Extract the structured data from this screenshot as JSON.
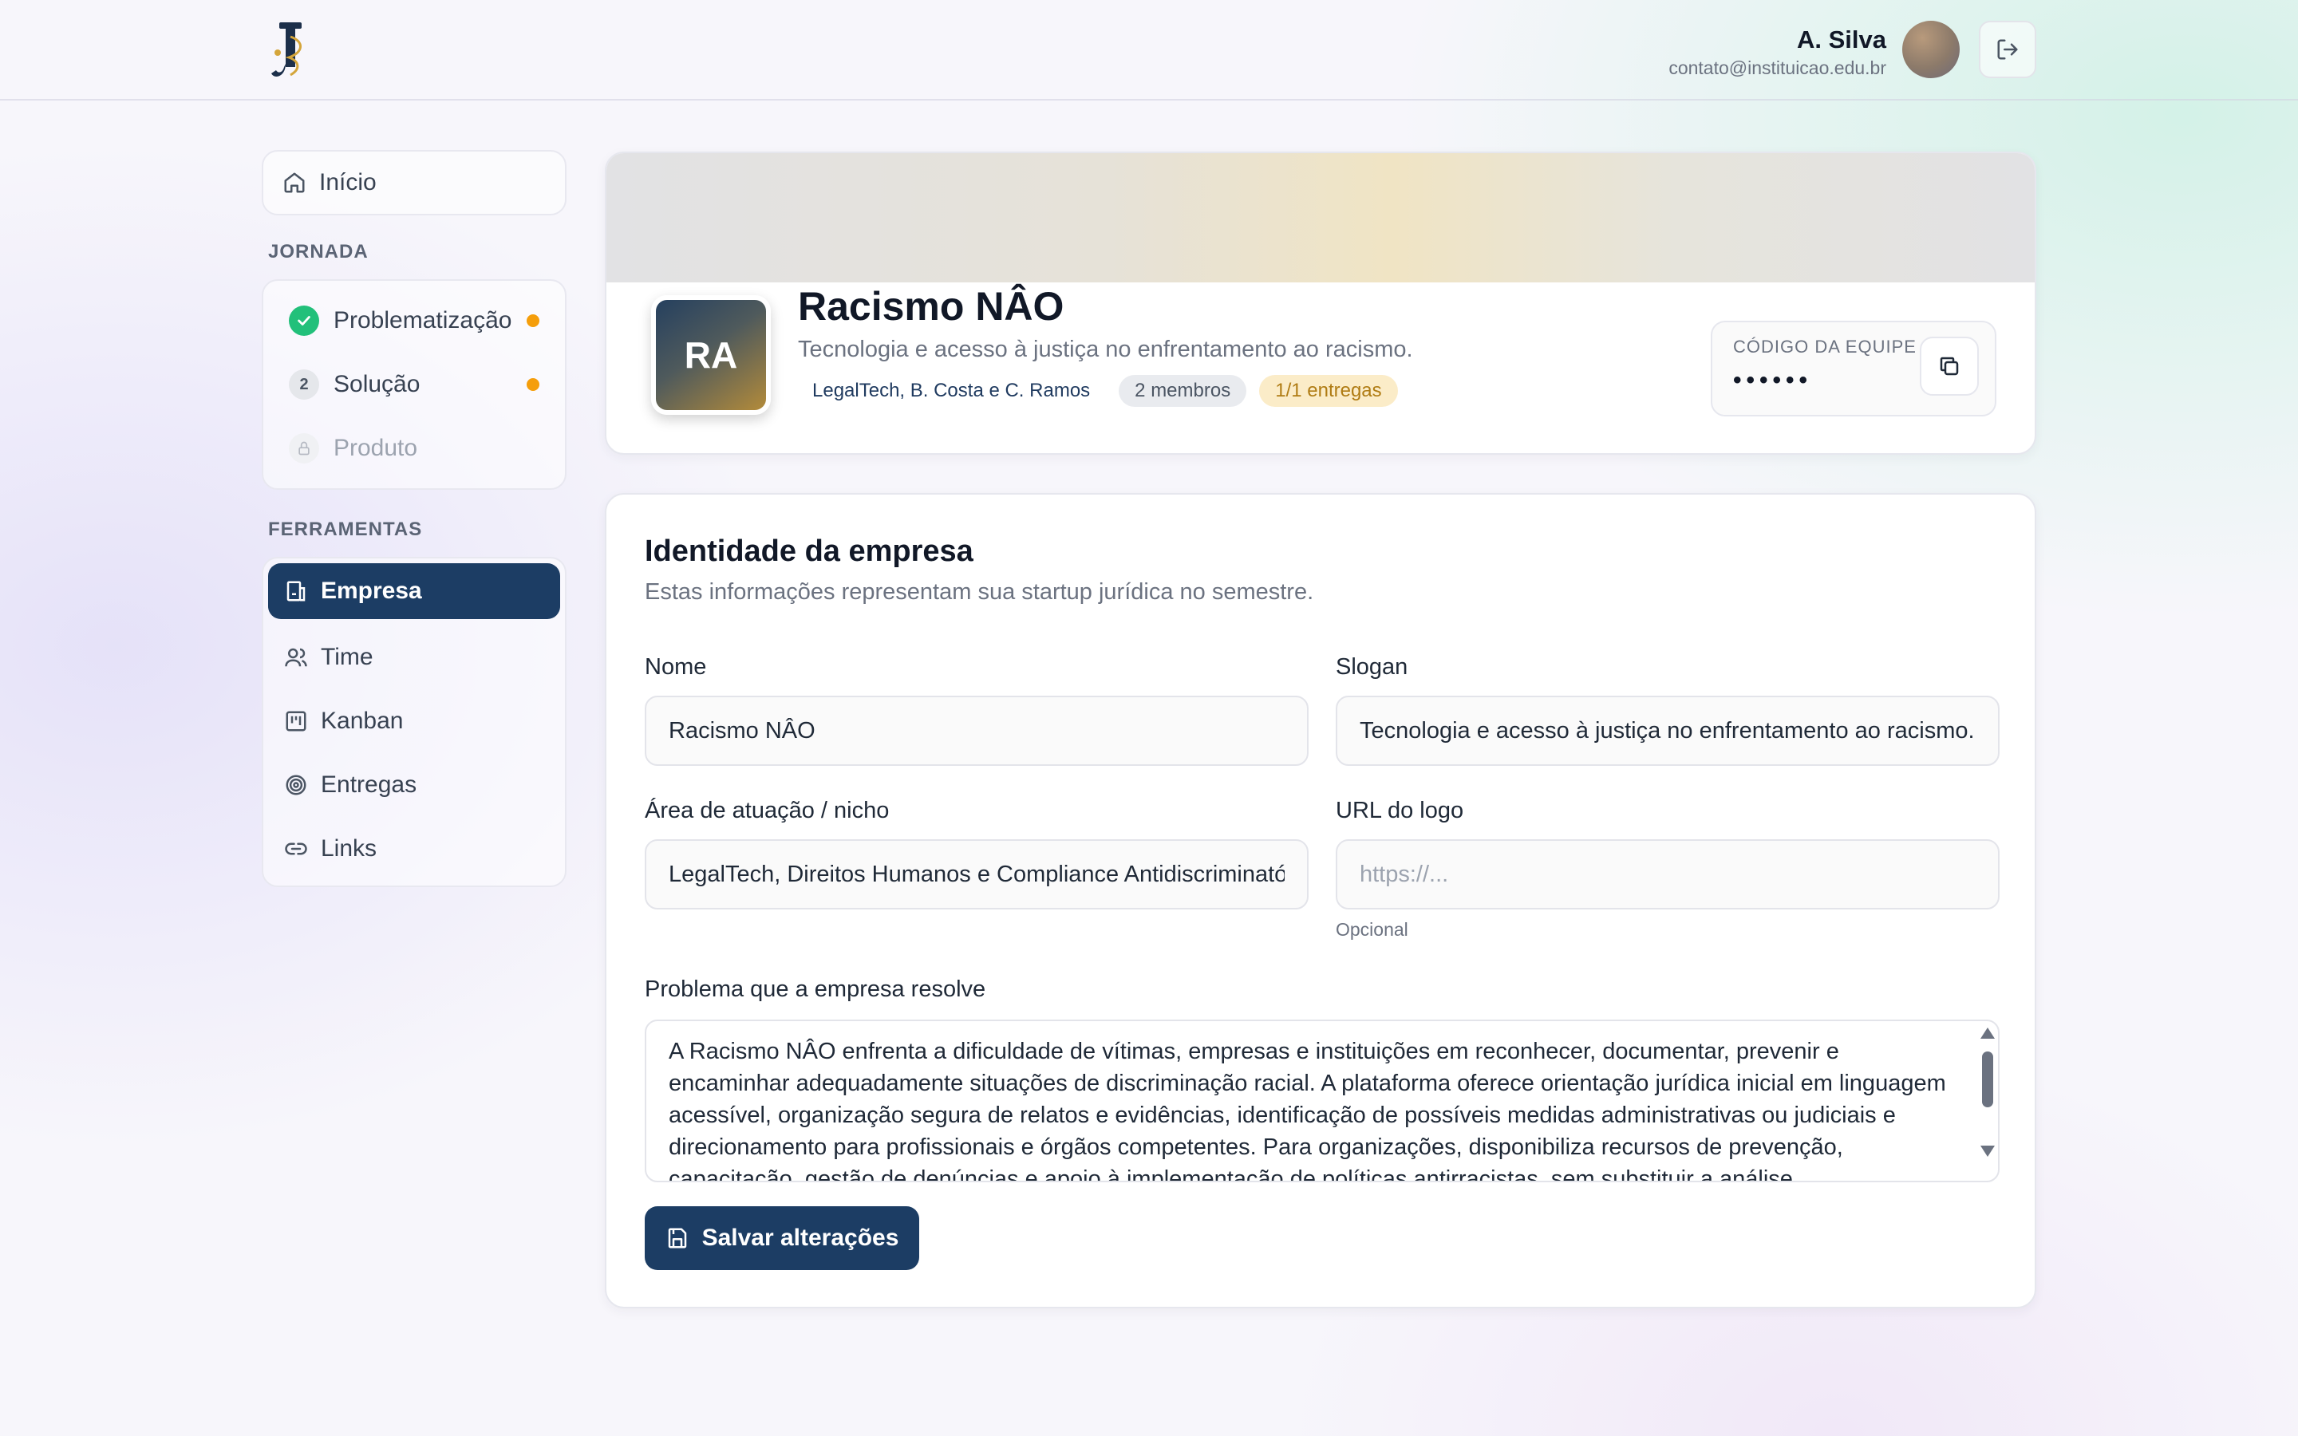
{
  "header": {
    "user_name": "A. Silva",
    "user_email": "contato@instituicao.edu.br"
  },
  "sidebar": {
    "home_label": "Início",
    "journey_title": "JORNADA",
    "journey_items": [
      {
        "label": "Problematização",
        "status": "done"
      },
      {
        "label": "Solução",
        "number": "2",
        "status": "pending"
      },
      {
        "label": "Produto",
        "status": "locked"
      }
    ],
    "tools_title": "FERRAMENTAS",
    "tools_items": [
      {
        "label": "Empresa",
        "icon": "building-icon",
        "active": true
      },
      {
        "label": "Time",
        "icon": "users-icon"
      },
      {
        "label": "Kanban",
        "icon": "kanban-icon"
      },
      {
        "label": "Entregas",
        "icon": "target-icon"
      },
      {
        "label": "Links",
        "icon": "link-icon"
      }
    ]
  },
  "company": {
    "initials": "RA",
    "name": "Racismo NÂO",
    "slogan": "Tecnologia e acesso à justiça no enfrentamento ao racismo.",
    "area_pill": "LegalTech, B. Costa e C. Ramos",
    "members_pill": "2 membros",
    "deliveries_pill": "1/1 entregas",
    "team_code_label": "CÓDIGO DA EQUIPE",
    "team_code_value": "••••••"
  },
  "form": {
    "title": "Identidade da empresa",
    "subtitle": "Estas informações representam sua startup jurídica no semestre.",
    "name_label": "Nome",
    "name_value": "Racismo NÂO",
    "slogan_label": "Slogan",
    "slogan_value": "Tecnologia e acesso à justiça no enfrentamento ao racismo.",
    "area_label": "Área de atuação / nicho",
    "area_value": "LegalTech, Direitos Humanos e Compliance Antidiscriminatório",
    "logo_label": "URL do logo",
    "logo_placeholder": "https://...",
    "logo_hint": "Opcional",
    "problem_label": "Problema que a empresa resolve",
    "problem_value": "A Racismo NÂO enfrenta a dificuldade de vítimas, empresas e instituições em reconhecer, documentar, prevenir e encaminhar adequadamente situações de discriminação racial. A plataforma oferece orientação jurídica inicial em linguagem acessível, organização segura de relatos e evidências, identificação de possíveis medidas administrativas ou judiciais e direcionamento para profissionais e órgãos competentes. Para organizações, disponibiliza recursos de prevenção, capacitação, gestão de denúncias e apoio à implementação de políticas antirracistas, sem substituir a análise",
    "save_label": "Salvar alterações"
  },
  "colors": {
    "primary": "#1c3d64",
    "success": "#22c07a",
    "warning": "#f59e0b"
  }
}
